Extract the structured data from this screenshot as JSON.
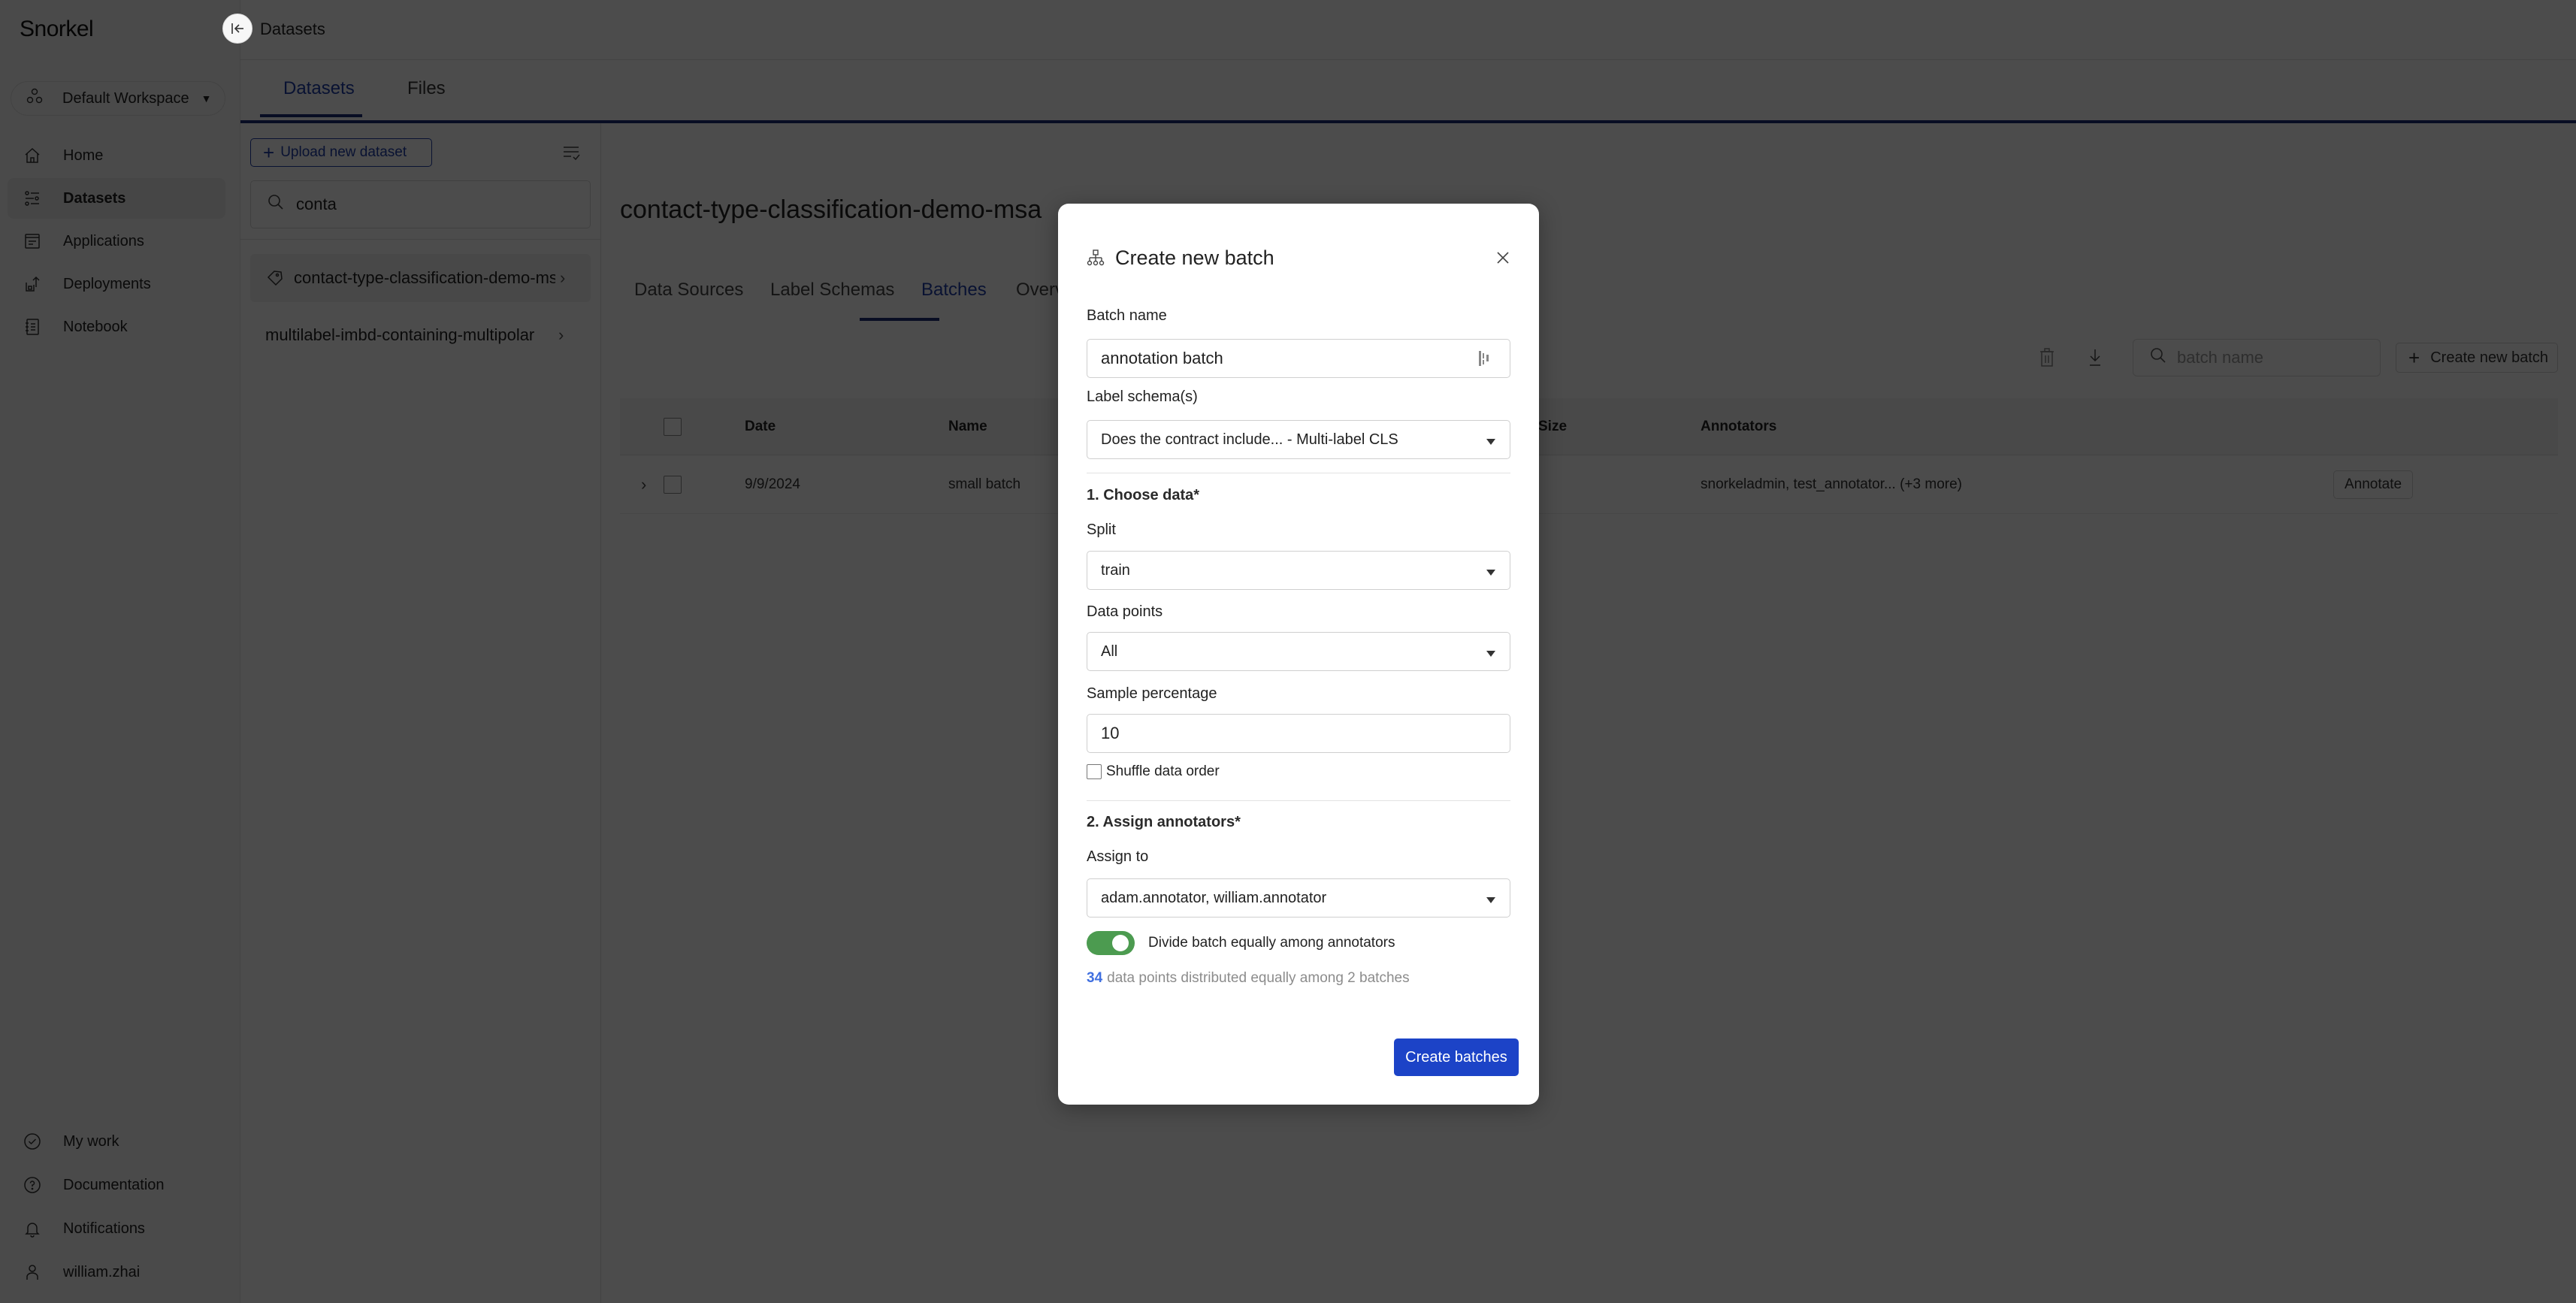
{
  "app": {
    "logo": "Snorkel",
    "breadcrumb": "Datasets"
  },
  "sidebar": {
    "workspace": "Default Workspace",
    "nav_top": [
      {
        "label": "Home",
        "icon": "home-icon",
        "active": false
      },
      {
        "label": "Datasets",
        "icon": "datasets-icon",
        "active": true
      },
      {
        "label": "Applications",
        "icon": "applications-icon",
        "active": false
      },
      {
        "label": "Deployments",
        "icon": "deployments-icon",
        "active": false
      },
      {
        "label": "Notebook",
        "icon": "notebook-icon",
        "active": false
      }
    ],
    "nav_bottom": [
      {
        "label": "My work",
        "icon": "check-circle-icon"
      },
      {
        "label": "Documentation",
        "icon": "help-circle-icon"
      },
      {
        "label": "Notifications",
        "icon": "bell-icon"
      },
      {
        "label": "william.zhai",
        "icon": "user-icon"
      }
    ]
  },
  "subtabs": [
    {
      "label": "Datasets",
      "active": true
    },
    {
      "label": "Files",
      "active": false
    }
  ],
  "dataset_panel": {
    "upload_label": "Upload new dataset",
    "search_value": "conta",
    "items": [
      {
        "name": "contact-type-classification-demo-msa",
        "active": true,
        "icon": "tag-icon"
      },
      {
        "name": "multilabel-imbd-containing-multipolar",
        "active": false
      }
    ]
  },
  "main": {
    "dataset_title": "contact-type-classification-demo-msa",
    "tabs": [
      {
        "label": "Data Sources",
        "active": false
      },
      {
        "label": "Label Schemas",
        "active": false
      },
      {
        "label": "Batches",
        "active": true
      },
      {
        "label": "Overview",
        "active": false
      }
    ],
    "batch_search_placeholder": "batch name",
    "create_batch_label": "Create new batch",
    "table": {
      "columns": [
        "Date",
        "Name",
        "Size",
        "Annotators"
      ],
      "rows": [
        {
          "date": "9/9/2024",
          "name": "small batch",
          "size": "",
          "annotators": "snorkeladmin, test_annotator... (+3 more)",
          "action": "Annotate"
        }
      ]
    }
  },
  "modal": {
    "title": "Create new batch",
    "batch_name_label": "Batch name",
    "batch_name_value": "annotation batch",
    "label_schema_label": "Label schema(s)",
    "label_schema_value": "Does the contract include... - Multi-label CLS",
    "section1_title": "1. Choose data*",
    "split_label": "Split",
    "split_value": "train",
    "data_points_label": "Data points",
    "data_points_value": "All",
    "sample_pct_label": "Sample percentage",
    "sample_pct_value": "10",
    "shuffle_label": "Shuffle data order",
    "shuffle_checked": false,
    "section2_title": "2. Assign annotators*",
    "assign_to_label": "Assign to",
    "assign_to_value": "adam.annotator, william.annotator",
    "divide_label": "Divide batch equally among annotators",
    "divide_enabled": true,
    "distribution_count": "34",
    "distribution_text": "data points distributed equally among 2 batches",
    "submit_label": "Create batches"
  },
  "colors": {
    "accent": "#1c43c7",
    "tab_active": "#1f3fa8",
    "toggle_on": "#4c9b50",
    "count_highlight": "#3f6fe0"
  }
}
